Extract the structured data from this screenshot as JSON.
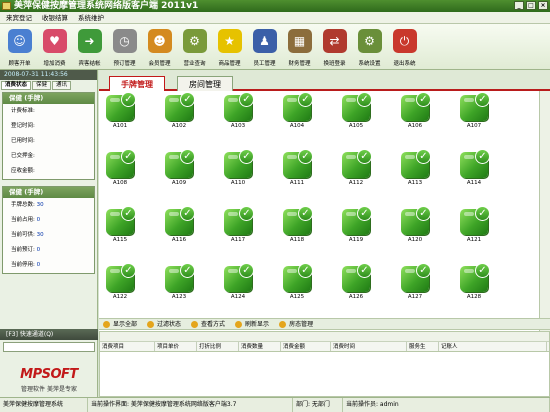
{
  "window": {
    "title": "美萍保健按摩管理系统网络版客户端 2011v1"
  },
  "menu": [
    "来宾登记",
    "收银结算",
    "系统维护"
  ],
  "toolbar": [
    {
      "label": "顾客开单",
      "icon": "customer-order-icon",
      "color": "#4a7fd1",
      "glyph": "☺"
    },
    {
      "label": "增加消费",
      "icon": "add-consumption-icon",
      "color": "#d84b6a",
      "glyph": "♥"
    },
    {
      "label": "宾客结帐",
      "icon": "checkout-icon",
      "color": "#3f9a3a",
      "glyph": "➜"
    },
    {
      "label": "预订管理",
      "icon": "clock-icon",
      "color": "#8a8a8a",
      "glyph": "◷"
    },
    {
      "label": "会员管理",
      "icon": "members-icon",
      "color": "#d48a1f",
      "glyph": "☻"
    },
    {
      "label": "营业查询",
      "icon": "query-icon",
      "color": "#7a9a3a",
      "glyph": "⚙"
    },
    {
      "label": "商品管理",
      "icon": "star-icon",
      "color": "#e6c200",
      "glyph": "★"
    },
    {
      "label": "员工管理",
      "icon": "staff-icon",
      "color": "#3b5fa8",
      "glyph": "♟"
    },
    {
      "label": "财务管理",
      "icon": "calculator-icon",
      "color": "#8c6d3c",
      "glyph": "▦"
    },
    {
      "label": "换班登录",
      "icon": "shift-login-icon",
      "color": "#b03a2e",
      "glyph": "⇄"
    },
    {
      "label": "系统设置",
      "icon": "settings-icon",
      "color": "#6a8f3a",
      "glyph": "⚙"
    },
    {
      "label": "退出系统",
      "icon": "exit-icon",
      "color": "#c9382c",
      "glyph": "⏻"
    }
  ],
  "left": {
    "datetime": "2008-07-31 11:43:56",
    "tabs": [
      "消费状态",
      "保健",
      "通讯"
    ],
    "status_panel": {
      "title": "保健 (手牌)",
      "fields": [
        "计费标准:",
        "登记时间:",
        "已用时间:",
        "已交押金:",
        "应收金额:"
      ]
    },
    "summary_panel": {
      "title": "保健 (手牌)",
      "fields": [
        {
          "label": "手牌总数:",
          "value": "30"
        },
        {
          "label": "当前占用:",
          "value": "0"
        },
        {
          "label": "当前可供:",
          "value": "30"
        },
        {
          "label": "当前预订:",
          "value": "0"
        },
        {
          "label": "当前停用:",
          "value": "0"
        }
      ]
    },
    "quick": {
      "title": "[F3] 快速通道(Q)"
    },
    "logo": {
      "brand": "MPSOFT",
      "slogan": "管理软件 美萍是专家"
    }
  },
  "main": {
    "tabs": [
      "手牌管理",
      "房间管理"
    ],
    "rooms": [
      "A101",
      "A102",
      "A103",
      "A104",
      "A105",
      "A106",
      "A107",
      "A108",
      "A109",
      "A110",
      "A111",
      "A112",
      "A113",
      "A114",
      "A115",
      "A116",
      "A117",
      "A118",
      "A119",
      "A120",
      "A121",
      "A122",
      "A123",
      "A124",
      "A125",
      "A126",
      "A127",
      "A128"
    ]
  },
  "actions": [
    "显示全部",
    "过滤状态",
    "查看方式",
    "刷新显示",
    "房态管理"
  ],
  "consumption_table": {
    "columns": [
      "消费项目",
      "项目单价",
      "打折比例",
      "消费数量",
      "消费金额",
      "消费时间",
      "服务生",
      "记账人"
    ]
  },
  "statusbar": {
    "system": "美萍保健按摩管理系统",
    "interface": "当前操作界面: 美萍保健按摩管理系统网络版客户端3.7",
    "dept": "部门: 无部门",
    "operator": "当前操作员: admin"
  }
}
